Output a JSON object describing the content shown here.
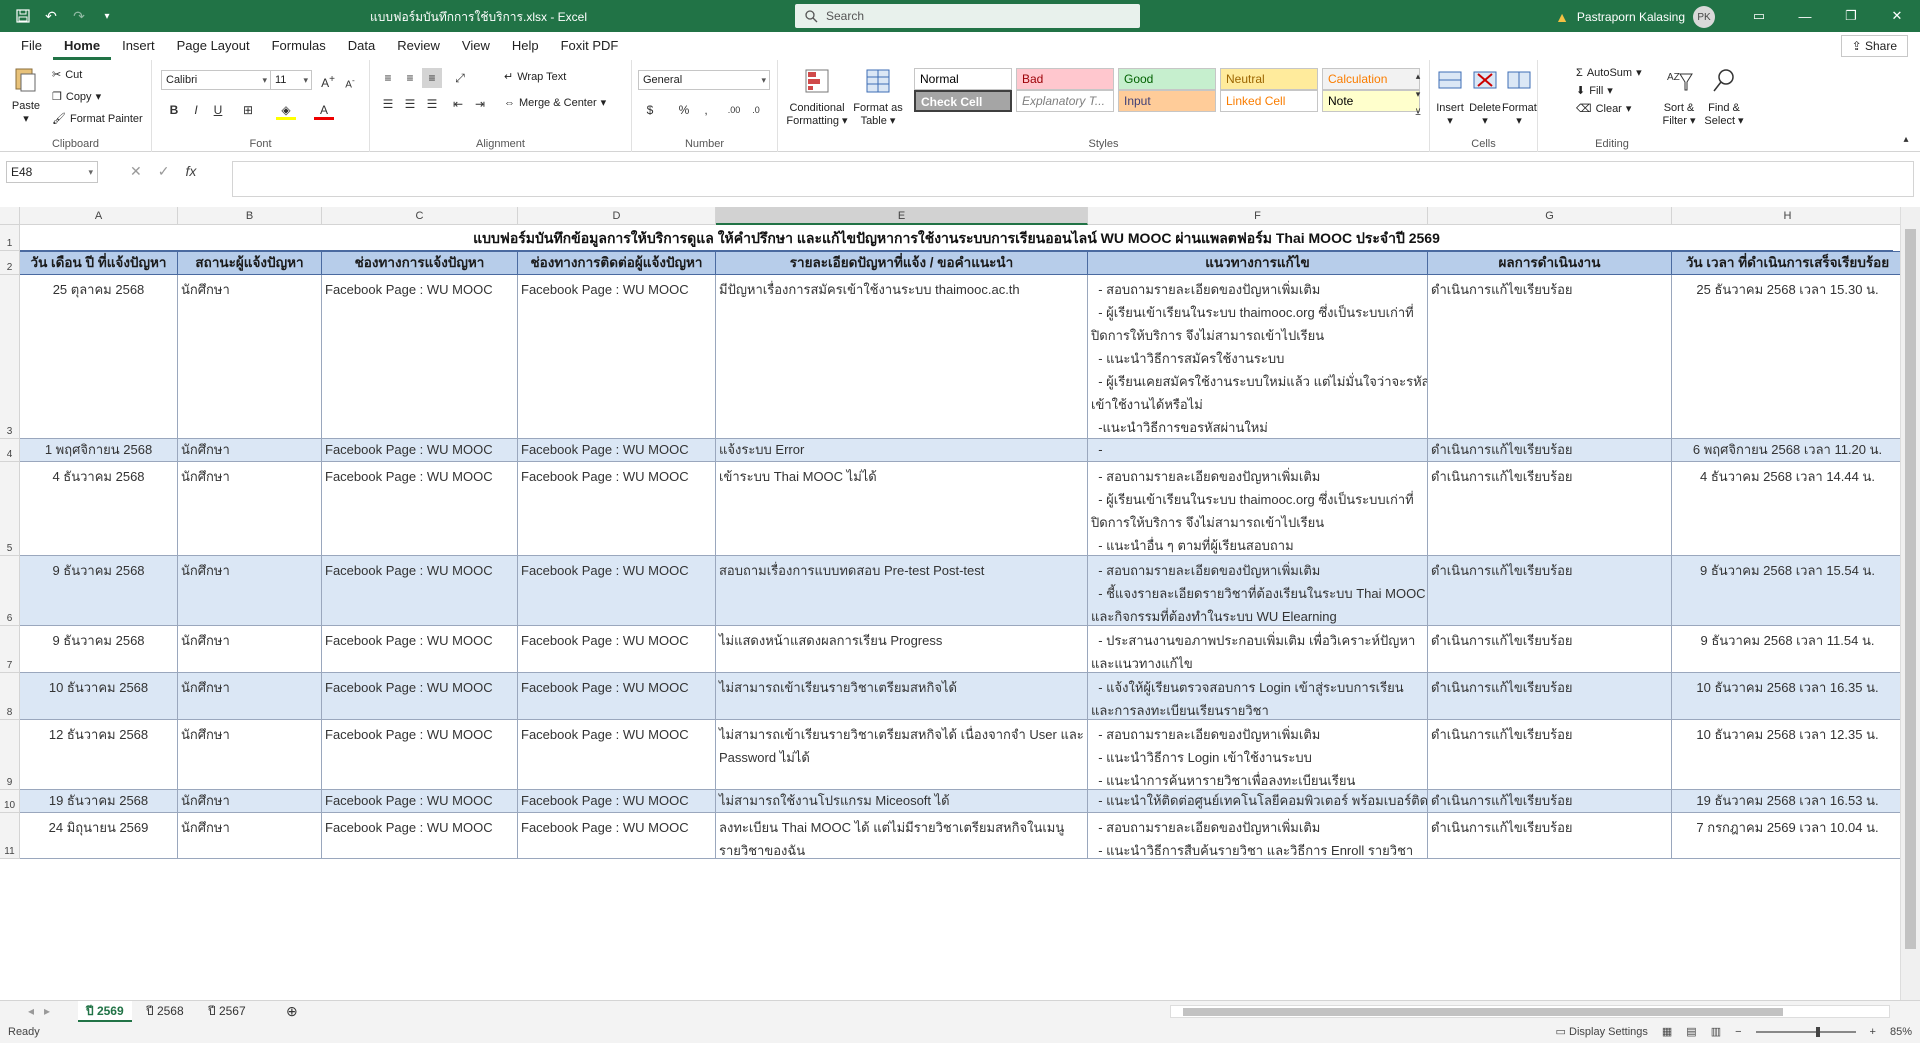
{
  "titlebar": {
    "doc_title": "แบบฟอร์มบันทึกการใช้บริการ.xlsx  -  Excel",
    "search_placeholder": "Search",
    "user_name": "Pastraporn Kalasing",
    "user_initials": "PK"
  },
  "tabs": [
    "File",
    "Home",
    "Insert",
    "Page Layout",
    "Formulas",
    "Data",
    "Review",
    "View",
    "Help",
    "Foxit PDF"
  ],
  "share_label": "Share",
  "ribbon": {
    "clipboard": {
      "paste": "Paste",
      "cut": "Cut",
      "copy": "Copy",
      "format_painter": "Format Painter",
      "label": "Clipboard"
    },
    "font": {
      "name": "Calibri",
      "size": "11",
      "label": "Font"
    },
    "alignment": {
      "wrap_text": "Wrap Text",
      "merge_center": "Merge & Center",
      "label": "Alignment"
    },
    "number": {
      "format": "General",
      "label": "Number"
    },
    "styles": {
      "conditional": "Conditional Formatting",
      "format_table": "Format as Table",
      "cells": [
        {
          "label": "Normal",
          "bg": "#ffffff",
          "color": "#000000"
        },
        {
          "label": "Bad",
          "bg": "#ffc7ce",
          "color": "#9c0006"
        },
        {
          "label": "Good",
          "bg": "#c6efce",
          "color": "#006100"
        },
        {
          "label": "Neutral",
          "bg": "#ffeb9c",
          "color": "#9c6500"
        },
        {
          "label": "Calculation",
          "bg": "#f2f2f2",
          "color": "#fa7d00"
        },
        {
          "label": "Check Cell",
          "bg": "#a5a5a5",
          "color": "#ffffff"
        },
        {
          "label": "Explanatory T...",
          "bg": "#ffffff",
          "color": "#7f7f7f"
        },
        {
          "label": "Input",
          "bg": "#ffcc99",
          "color": "#3f3f76"
        },
        {
          "label": "Linked Cell",
          "bg": "#ffffff",
          "color": "#fa7d00"
        },
        {
          "label": "Note",
          "bg": "#ffffcc",
          "color": "#000000"
        }
      ],
      "label": "Styles"
    },
    "cells_group": {
      "insert": "Insert",
      "delete": "Delete",
      "format": "Format",
      "label": "Cells"
    },
    "editing": {
      "autosum": "AutoSum",
      "fill": "Fill",
      "clear": "Clear",
      "sort_filter": "Sort & Filter",
      "find_select": "Find & Select",
      "label": "Editing"
    }
  },
  "formula_bar": {
    "name_box": "E48",
    "fx": "fx",
    "value": ""
  },
  "columns": [
    "A",
    "B",
    "C",
    "D",
    "E",
    "F",
    "G",
    "H"
  ],
  "sheet": {
    "title": "แบบฟอร์มบันทึกข้อมูลการให้บริการดูแล ให้คำปรึกษา และแก้ไขปัญหาการใช้งานระบบการเรียนออนไลน์ WU MOOC ผ่านแพลตฟอร์ม Thai MOOC  ประจำปี 2569",
    "headers": [
      "วัน เดือน ปี ที่แจ้งปัญหา",
      "สถานะผู้แจ้งปัญหา",
      "ช่องทางการแจ้งปัญหา",
      "ช่องทางการติดต่อผู้แจ้งปัญหา",
      "รายละเอียดปัญหาที่แจ้ง / ขอคำแนะนำ",
      "แนวทางการแก้ไข",
      "ผลการดำเนินงาน",
      "วัน เวลา ที่ดำเนินการเสร็จเรียบร้อย"
    ],
    "rows": [
      {
        "num": "3",
        "date": "25 ตุลาคม 2568",
        "status": "นักศึกษา",
        "channel": "Facebook Page : WU MOOC",
        "contact": "Facebook Page : WU MOOC",
        "detail": "มีปัญหาเรื่องการสมัครเข้าใช้งานระบบ thaimooc.ac.th",
        "solution": [
          "  - สอบถามรายละเอียดของปัญหาเพิ่มเติม",
          "  - ผู้เรียนเข้าเรียนในระบบ thaimooc.org ซึ่งเป็นระบบเก่าที่",
          "ปิดการให้บริการ จึงไม่สามารถเข้าไปเรียน",
          "  - แนะนำวิธีการสมัครใช้งานระบบ",
          "  - ผู้เรียนเคยสมัครใช้งานระบบใหม่แล้ว แต่ไม่มั่นใจว่าจะรหัส",
          "เข้าใช้งานได้หรือไม่",
          "  -แนะนำวิธีการขอรหัสผ่านใหม่"
        ],
        "result": "ดำเนินการแก้ไขเรียบร้อย",
        "done": "25 ธันวาคม 2568 เวลา 15.30 น."
      },
      {
        "num": "4",
        "date": "1 พฤศจิกายน 2568",
        "status": "นักศึกษา",
        "channel": "Facebook Page : WU MOOC",
        "contact": "Facebook Page : WU MOOC",
        "detail": "แจ้งระบบ  Error",
        "solution": [
          "  -"
        ],
        "result": "ดำเนินการแก้ไขเรียบร้อย",
        "done": "6 พฤศจิกายน 2568 เวลา 11.20 น."
      },
      {
        "num": "5",
        "date": "4 ธันวาคม 2568",
        "status": "นักศึกษา",
        "channel": "Facebook Page : WU MOOC",
        "contact": "Facebook Page : WU MOOC",
        "detail": "เข้าระบบ Thai MOOC ไม่ได้",
        "solution": [
          "  - สอบถามรายละเอียดของปัญหาเพิ่มเติม",
          "  - ผู้เรียนเข้าเรียนในระบบ thaimooc.org ซึ่งเป็นระบบเก่าที่",
          "ปิดการให้บริการ จึงไม่สามารถเข้าไปเรียน",
          "  - แนะนำอื่น ๆ ตามที่ผู้เรียนสอบถาม"
        ],
        "result": "ดำเนินการแก้ไขเรียบร้อย",
        "done": "4 ธันวาคม 2568 เวลา 14.44 น."
      },
      {
        "num": "6",
        "date": "9 ธันวาคม 2568",
        "status": "นักศึกษา",
        "channel": "Facebook Page : WU MOOC",
        "contact": "Facebook Page : WU MOOC",
        "detail": "สอบถามเรื่องการแบบทดสอบ Pre-test Post-test",
        "solution": [
          "  - สอบถามรายละเอียดของปัญหาเพิ่มเติม",
          "  - ชี้แจงรายละเอียดรายวิชาที่ต้องเรียนในระบบ Thai MOOC",
          "และกิจกรรมที่ต้องทำในระบบ WU Elearning"
        ],
        "result": "ดำเนินการแก้ไขเรียบร้อย",
        "done": "9 ธันวาคม 2568 เวลา 15.54 น."
      },
      {
        "num": "7",
        "date": "9 ธันวาคม 2568",
        "status": "นักศึกษา",
        "channel": "Facebook Page : WU MOOC",
        "contact": "Facebook Page : WU MOOC",
        "detail": "ไม่แสดงหน้าแสดงผลการเรียน Progress",
        "solution": [
          "  - ประสานงานขอภาพประกอบเพิ่มเติม เพื่อวิเคราะห์ปัญหา",
          "และแนวทางแก้ไข"
        ],
        "result": "ดำเนินการแก้ไขเรียบร้อย",
        "done": "9 ธันวาคม 2568 เวลา 11.54 น."
      },
      {
        "num": "8",
        "date": "10 ธันวาคม 2568",
        "status": "นักศึกษา",
        "channel": "Facebook Page : WU MOOC",
        "contact": "Facebook Page : WU MOOC",
        "detail": "ไม่สามารถเข้าเรียนรายวิชาเตรียมสหกิจได้",
        "solution": [
          "  - แจ้งให้ผู้เรียนตรวจสอบการ Login เข้าสู่ระบบการเรียน",
          "และการลงทะเบียนเรียนรายวิชา"
        ],
        "result": "ดำเนินการแก้ไขเรียบร้อย",
        "done": "10 ธันวาคม 2568 เวลา 16.35 น."
      },
      {
        "num": "9",
        "date": "12 ธันวาคม 2568",
        "status": "นักศึกษา",
        "channel": "Facebook Page : WU MOOC",
        "contact": "Facebook Page : WU MOOC",
        "detail": "ไม่สามารถเข้าเรียนรายวิชาเตรียมสหกิจได้ เนื่องจากจำ User และ|Password ไม่ได้",
        "solution": [
          "  - สอบถามรายละเอียดของปัญหาเพิ่มเติม",
          "  - แนะนำวิธีการ Login เข้าใช้งานระบบ",
          "  - แนะนำการค้นหารายวิชาเพื่อลงทะเบียนเรียน"
        ],
        "result": "ดำเนินการแก้ไขเรียบร้อย",
        "done": "10 ธันวาคม 2568 เวลา 12.35 น."
      },
      {
        "num": "10",
        "date": "19 ธันวาคม 2568",
        "status": "นักศึกษา",
        "channel": "Facebook Page : WU MOOC",
        "contact": "Facebook Page : WU MOOC",
        "detail": " ไม่สามารถใช้งานโปรแกรม Miceosoft ได้",
        "solution": [
          "  - แนะนำให้ติดต่อศูนย์เทคโนโลยีคอมพิวเตอร์ พร้อมเบอร์ติดต่อ"
        ],
        "result": "ดำเนินการแก้ไขเรียบร้อย",
        "done": "19 ธันวาคม 2568 เวลา 16.53 น."
      },
      {
        "num": "11",
        "date": "24 มิถุนายน 2569",
        "status": "นักศึกษา",
        "channel": "Facebook Page : WU MOOC",
        "contact": "Facebook Page : WU MOOC",
        "detail": " ลงทะเบียน Thai MOOC ได้ แต่ไม่มีรายวิชาเตรียมสหกิจในเมนู|รายวิชาของฉัน",
        "solution": [
          "  - สอบถามรายละเอียดของปัญหาเพิ่มเติม",
          "  - แนะนำวิธีการสืบค้นรายวิชา และวิธีการ Enroll รายวิชา"
        ],
        "result": "ดำเนินการแก้ไขเรียบร้อย",
        "done": "7 กรกฎาคม 2569 เวลา 10.04 น."
      }
    ]
  },
  "sheet_tabs": [
    "ปี 2569",
    "ปี 2568",
    "ปี 2567"
  ],
  "status": {
    "ready": "Ready",
    "display_settings": "Display Settings",
    "zoom": "85%"
  },
  "colors": {
    "excel_green": "#217346",
    "header_blue": "#b7cdea",
    "row_band": "#dbe7f5"
  }
}
